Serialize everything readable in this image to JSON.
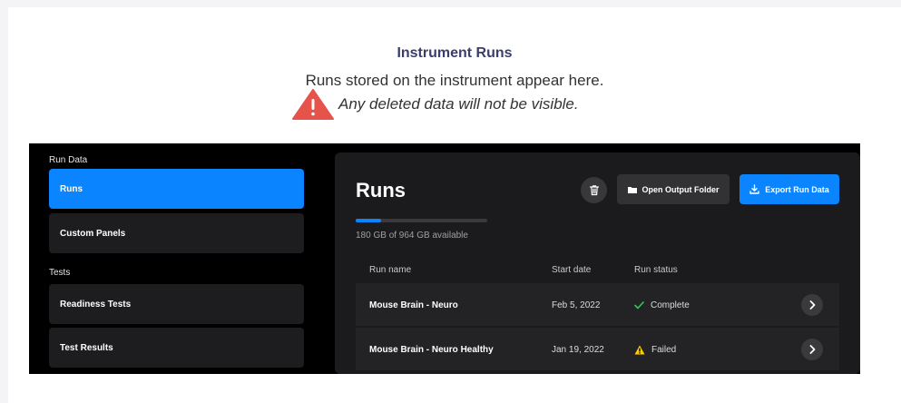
{
  "header": {
    "title": "Instrument Runs",
    "subtitle": "Runs stored on the instrument appear here.",
    "warning_text": "Any deleted data will not be visible.",
    "warning_icon": "warning-triangle-icon",
    "warning_color": "#e5534b"
  },
  "sidebar": {
    "run_data_heading": "Run Data",
    "tests_heading": "Tests",
    "items": [
      {
        "label": "Runs",
        "active": true
      },
      {
        "label": "Custom Panels",
        "active": false
      },
      {
        "label": "Readiness Tests",
        "active": false
      },
      {
        "label": "Test Results",
        "active": false
      }
    ]
  },
  "main": {
    "title": "Runs",
    "trash_icon": "trash-icon",
    "open_folder_label": "Open Output Folder",
    "open_folder_icon": "folder-icon",
    "export_label": "Export Run Data",
    "export_icon": "download-icon",
    "accent_color": "#0a84ff",
    "storage": {
      "used_fraction": 0.19,
      "text": "180 GB  of 964 GB available"
    },
    "columns": [
      "Run name",
      "Start date",
      "Run status"
    ],
    "rows": [
      {
        "name": "Mouse Brain - Neuro",
        "date": "Feb 5, 2022",
        "status": "Complete",
        "status_icon": "check-icon",
        "status_color": "#34c759"
      },
      {
        "name": "Mouse Brain - Neuro Healthy",
        "date": "Jan 19, 2022",
        "status": "Failed",
        "status_icon": "warning-icon",
        "status_color": "#ffcc00"
      }
    ]
  }
}
